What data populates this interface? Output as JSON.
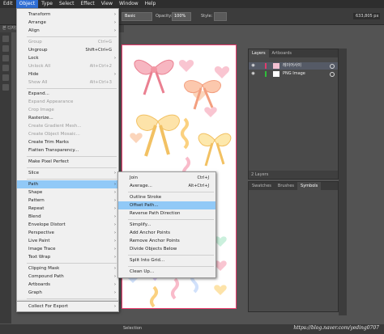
{
  "menubar": {
    "items": [
      "Edit",
      "Object",
      "Type",
      "Select",
      "Effect",
      "View",
      "Window",
      "Help"
    ]
  },
  "control_bar": {
    "style_preset": "Basic",
    "opacity_label": "Opacity:",
    "opacity_value": "100%",
    "style_label": "Style:",
    "workspace": "633,805 px"
  },
  "document_tab": "본 디자인...",
  "object_menu": {
    "items": [
      {
        "label": "Transform",
        "shortcut": "",
        "submenu": true,
        "disabled": false
      },
      {
        "label": "Arrange",
        "shortcut": "",
        "submenu": true,
        "disabled": false
      },
      {
        "label": "Align",
        "shortcut": "",
        "submenu": true,
        "disabled": false
      },
      {
        "label": "Group",
        "shortcut": "Ctrl+G",
        "submenu": false,
        "disabled": true
      },
      {
        "label": "Ungroup",
        "shortcut": "Shift+Ctrl+G",
        "submenu": false,
        "disabled": false
      },
      {
        "label": "Lock",
        "shortcut": "",
        "submenu": true,
        "disabled": false
      },
      {
        "label": "Unlock All",
        "shortcut": "Alt+Ctrl+2",
        "submenu": false,
        "disabled": true
      },
      {
        "label": "Hide",
        "shortcut": "",
        "submenu": true,
        "disabled": false
      },
      {
        "label": "Show All",
        "shortcut": "Alt+Ctrl+3",
        "submenu": false,
        "disabled": true
      },
      {
        "label": "Expand...",
        "shortcut": "",
        "submenu": false,
        "disabled": false
      },
      {
        "label": "Expand Appearance",
        "shortcut": "",
        "submenu": false,
        "disabled": true
      },
      {
        "label": "Crop Image",
        "shortcut": "",
        "submenu": false,
        "disabled": true
      },
      {
        "label": "Rasterize...",
        "shortcut": "",
        "submenu": false,
        "disabled": false
      },
      {
        "label": "Create Gradient Mesh...",
        "shortcut": "",
        "submenu": false,
        "disabled": true
      },
      {
        "label": "Create Object Mosaic...",
        "shortcut": "",
        "submenu": false,
        "disabled": true
      },
      {
        "label": "Create Trim Marks",
        "shortcut": "",
        "submenu": false,
        "disabled": false
      },
      {
        "label": "Flatten Transparency...",
        "shortcut": "",
        "submenu": false,
        "disabled": false
      },
      {
        "label": "Make Pixel Perfect",
        "shortcut": "",
        "submenu": false,
        "disabled": false
      },
      {
        "label": "Slice",
        "shortcut": "",
        "submenu": true,
        "disabled": false
      },
      {
        "label": "Path",
        "shortcut": "",
        "submenu": true,
        "disabled": false,
        "highlighted": true
      },
      {
        "label": "Shape",
        "shortcut": "",
        "submenu": true,
        "disabled": false
      },
      {
        "label": "Pattern",
        "shortcut": "",
        "submenu": true,
        "disabled": false
      },
      {
        "label": "Repeat",
        "shortcut": "",
        "submenu": true,
        "disabled": false
      },
      {
        "label": "Blend",
        "shortcut": "",
        "submenu": true,
        "disabled": false
      },
      {
        "label": "Envelope Distort",
        "shortcut": "",
        "submenu": true,
        "disabled": false
      },
      {
        "label": "Perspective",
        "shortcut": "",
        "submenu": true,
        "disabled": false
      },
      {
        "label": "Live Paint",
        "shortcut": "",
        "submenu": true,
        "disabled": false
      },
      {
        "label": "Image Trace",
        "shortcut": "",
        "submenu": true,
        "disabled": false
      },
      {
        "label": "Text Wrap",
        "shortcut": "",
        "submenu": true,
        "disabled": false
      },
      {
        "label": "Clipping Mask",
        "shortcut": "",
        "submenu": true,
        "disabled": false
      },
      {
        "label": "Compound Path",
        "shortcut": "",
        "submenu": true,
        "disabled": false
      },
      {
        "label": "Artboards",
        "shortcut": "",
        "submenu": true,
        "disabled": false
      },
      {
        "label": "Graph",
        "shortcut": "",
        "submenu": true,
        "disabled": false
      },
      {
        "label": "Collect For Export",
        "shortcut": "",
        "submenu": true,
        "disabled": false
      }
    ]
  },
  "path_submenu": {
    "items": [
      {
        "label": "Join",
        "shortcut": "Ctrl+J"
      },
      {
        "label": "Average...",
        "shortcut": "Alt+Ctrl+J"
      },
      {
        "label": "Outline Stroke",
        "shortcut": ""
      },
      {
        "label": "Offset Path...",
        "shortcut": "",
        "highlighted": true
      },
      {
        "label": "Reverse Path Direction",
        "shortcut": ""
      },
      {
        "label": "Simplify...",
        "shortcut": ""
      },
      {
        "label": "Add Anchor Points",
        "shortcut": ""
      },
      {
        "label": "Remove Anchor Points",
        "shortcut": ""
      },
      {
        "label": "Divide Objects Below",
        "shortcut": ""
      },
      {
        "label": "Split Into Grid...",
        "shortcut": ""
      },
      {
        "label": "Clean Up...",
        "shortcut": ""
      }
    ]
  },
  "layers_panel": {
    "tabs": [
      "Layers",
      "Artboards"
    ],
    "layers": [
      {
        "name": "레이어사이",
        "color": "#e23b6b"
      },
      {
        "name": "PNG Image",
        "color": "#2fbf3a"
      }
    ],
    "footer": "2 Layers"
  },
  "symbols_panel": {
    "tabs": [
      "Swatches",
      "Brushes",
      "Symbols"
    ]
  },
  "status": {
    "tool": "Selection",
    "watermark": "https://blog.naver.com/yeding0707"
  },
  "colors": {
    "menu_highlight": "#91c9f7",
    "menubar_active": "#2f6fd6"
  }
}
